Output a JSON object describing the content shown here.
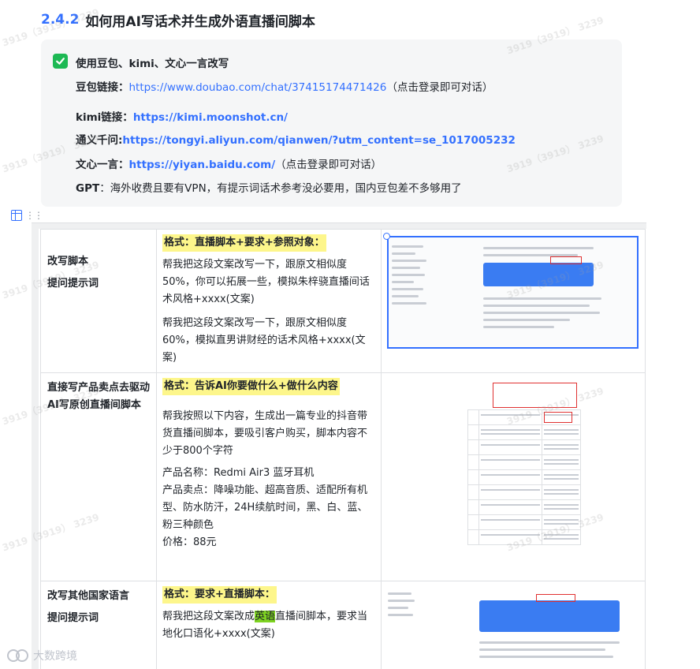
{
  "heading": {
    "number": "2.4.2",
    "title": "如何用AI写话术并生成外语直播间脚本"
  },
  "callout": {
    "checked": true,
    "title": "使用豆包、kimi、文心一言改写",
    "doubao": {
      "label": "豆包链接：",
      "url": "https://www.doubao.com/chat/37415174471426",
      "note": "（点击登录即可对话）"
    },
    "kimi": {
      "label": "kimi链接：",
      "url": "https://kimi.moonshot.cn/"
    },
    "tongyi": {
      "label": "通义千问:",
      "url": "https://tongyi.aliyun.com/qianwen/?utm_content=se_1017005232"
    },
    "wenxin": {
      "label": "文心一言：",
      "url": "https://yiyan.baidu.com/",
      "note": "（点击登录即可对话）"
    },
    "gpt": {
      "label": "GPT",
      "text": "：海外收费且要有VPN，有提示词话术参考没必要用，国内豆包差不多够用了"
    }
  },
  "table": {
    "rows": [
      {
        "col1_line1": "改写脚本",
        "col1_line2": "提问提示词",
        "format": "格式：直播脚本+要求+参照对象：",
        "para1": "帮我把这段文案改写一下，跟原文相似度50%，你可以拓展一些，模拟朱梓骁直播间话术风格+xxxx(文案)",
        "para2": "帮我把这段文案改写一下，跟原文相似度60%，模拟直男讲财经的话术风格+xxxx(文案)"
      },
      {
        "col1_line1": "直接写产品卖点去驱动",
        "col1_line2": "AI写原创直播间脚本",
        "format": "格式：告诉AI你要做什么+做什么内容",
        "para1": "帮我按照以下内容，生成出一篇专业的抖音带货直播间脚本，要吸引客户购买，脚本内容不少于800个字符",
        "product_name": "产品名称：Redmi Air3 蓝牙耳机",
        "product_points": "产品卖点：降噪功能、超高音质、适配所有机型、防水防汗，24H续航时间，黑、白、蓝、粉三种颜色",
        "price": "价格：88元"
      },
      {
        "col1_line1": "改写其他国家语言",
        "col1_line2": "提问提示词",
        "format": "格式：要求+直播脚本：",
        "para1_a": "帮我把这段文案改成",
        "para1_hl": "英语",
        "para1_b": "直播间脚本，要求当地化口语化+xxxx(文案)"
      }
    ]
  },
  "brand": {
    "text": "大数跨境"
  },
  "watermark": {
    "text": "3919（3919） 3239"
  },
  "colors": {
    "accent": "#3370ff",
    "highlight_yellow": "#fdf68b",
    "highlight_green": "#7ed321",
    "check_green": "#1db954"
  }
}
